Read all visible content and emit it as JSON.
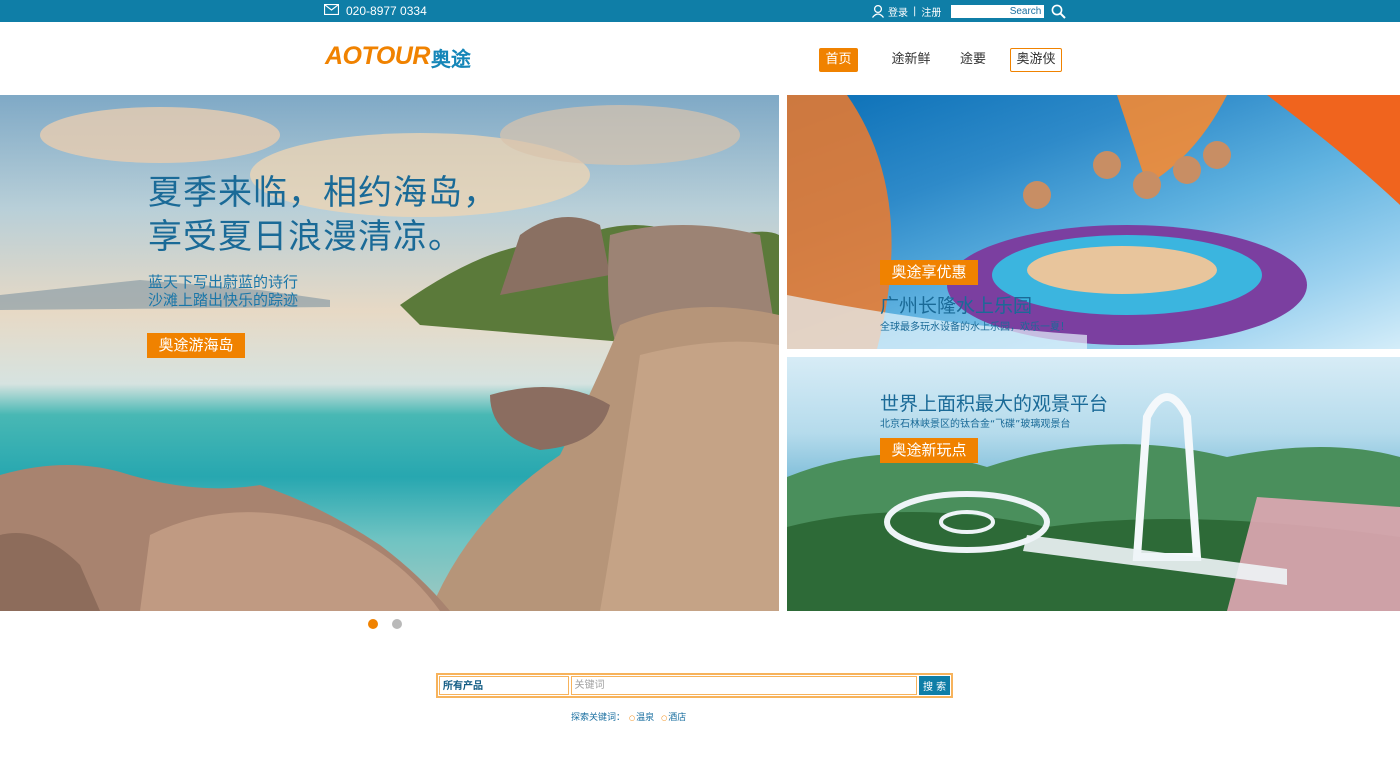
{
  "topbar": {
    "phone": "020-8977 0334",
    "login_label": "登录",
    "separator": "|",
    "register_label": "注册",
    "search_placeholder": "Search"
  },
  "header": {
    "logo_latin": "AOTOUR",
    "logo_cn": "奥途",
    "nav": [
      {
        "label": "首页",
        "state": "active"
      },
      {
        "label": "途新鲜",
        "state": "normal"
      },
      {
        "label": "途要",
        "state": "normal"
      },
      {
        "label": "奥游侠",
        "state": "outline"
      }
    ]
  },
  "banner": {
    "main": {
      "title_line1": "夏季来临，相约海岛，",
      "title_line2": "享受夏日浪漫清凉。",
      "sub_line1": "蓝天下写出蔚蓝的诗行",
      "sub_line2": "沙滩上踏出快乐的踪迹",
      "tag": "奥途游海岛"
    },
    "top_right": {
      "tag": "奥途享优惠",
      "title": "广州长隆水上乐园",
      "desc": "全球最多玩水设备的水上乐园，欢乐一夏！"
    },
    "bottom_right": {
      "title": "世界上面积最大的观景平台",
      "desc": "北京石林峡景区的钛合金“飞碟”玻璃观景台",
      "tag": "奥途新玩点"
    },
    "slides": [
      {
        "state": "on"
      },
      {
        "state": "off"
      }
    ]
  },
  "search": {
    "category": "所有产品",
    "keyword_placeholder": "关键词",
    "button": "搜 索",
    "hot_label": "探索关键词：",
    "hot_words": [
      "温泉",
      "酒店"
    ]
  },
  "colors": {
    "topbar": "#0f7ea7",
    "accent_orange": "#f08200",
    "brand_blue": "#1586b8",
    "search_border": "#f7b35c"
  }
}
